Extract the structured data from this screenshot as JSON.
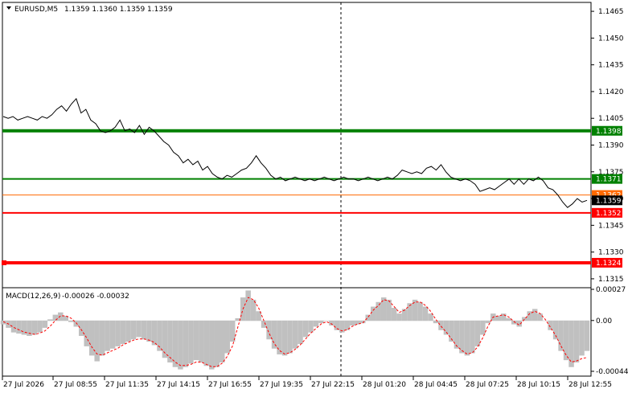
{
  "header": {
    "symbol": "EURUSD,M5",
    "ohlc": "1.1359 1.1360 1.1359 1.1359"
  },
  "macd": {
    "label": "MACD(12,26,9)",
    "values": "-0.00026 -0.00032",
    "y_ticks": [
      "0.00027",
      "0.00",
      "-0.00044"
    ]
  },
  "chart_data": [
    {
      "type": "line",
      "title": "EURUSD,M5",
      "y_ticks": [
        "1.1465",
        "1.1450",
        "1.1435",
        "1.1420",
        "1.1405",
        "1.1390",
        "1.1375",
        "1.1360",
        "1.1345",
        "1.1330",
        "1.1315"
      ],
      "x_ticks": [
        "27 Jul 2026",
        "27 Jul 08:55",
        "27 Jul 11:35",
        "27 Jul 14:15",
        "27 Jul 16:55",
        "27 Jul 19:35",
        "27 Jul 22:15",
        "28 Jul 01:20",
        "28 Jul 04:45",
        "28 Jul 07:25",
        "28 Jul 10:15",
        "28 Jul 12:55"
      ],
      "ylim": [
        1.131,
        1.147
      ],
      "grid": false,
      "series": [
        {
          "values": [
            1.1406,
            1.1405,
            1.1406,
            1.1404,
            1.1405,
            1.1406,
            1.1405,
            1.1404,
            1.1406,
            1.1405,
            1.1407,
            1.141,
            1.1412,
            1.1409,
            1.1413,
            1.1416,
            1.1408,
            1.141,
            1.1404,
            1.1402,
            1.1398,
            1.1397,
            1.1398,
            1.14,
            1.1404,
            1.1398,
            1.1399,
            1.1397,
            1.1401,
            1.1396,
            1.14,
            1.1398,
            1.1395,
            1.1392,
            1.139,
            1.1386,
            1.1384,
            1.138,
            1.1382,
            1.1379,
            1.1381,
            1.1376,
            1.1378,
            1.1374,
            1.1372,
            1.1371,
            1.1373,
            1.1372,
            1.1374,
            1.1376,
            1.1377,
            1.138,
            1.1384,
            1.138,
            1.1377,
            1.1373,
            1.1371,
            1.1372,
            1.137,
            1.1371,
            1.1372,
            1.1371,
            1.137,
            1.1371,
            1.137,
            1.1371,
            1.1372,
            1.1371,
            1.137,
            1.1371,
            1.1372,
            1.1371,
            1.1371,
            1.137,
            1.1371,
            1.1372,
            1.1371,
            1.137,
            1.1371,
            1.1372,
            1.1371,
            1.1373,
            1.1376,
            1.1375,
            1.1374,
            1.1375,
            1.1374,
            1.1377,
            1.1378,
            1.1376,
            1.1379,
            1.1375,
            1.1372,
            1.1371,
            1.137,
            1.1371,
            1.137,
            1.1368,
            1.1364,
            1.1365,
            1.1366,
            1.1365,
            1.1367,
            1.1369,
            1.1371,
            1.1368,
            1.1371,
            1.1368,
            1.1371,
            1.137,
            1.1372,
            1.137,
            1.1366,
            1.1365,
            1.1362,
            1.1358,
            1.1355,
            1.1357,
            1.136,
            1.1358,
            1.1359
          ]
        }
      ],
      "levels": [
        {
          "value": 1.1398,
          "label": "1.1398",
          "color": "#008000"
        },
        {
          "value": 1.1371,
          "label": "1.1371",
          "color": "#008000"
        },
        {
          "value": 1.1362,
          "label": "1.1362",
          "color": "#ff6a00"
        },
        {
          "value": 1.1352,
          "label": "1.1352",
          "color": "#ff0000"
        },
        {
          "value": 1.1324,
          "label": "1.1324",
          "color": "#ff0000"
        }
      ],
      "last_price": {
        "value": 1.1359,
        "label": "1.1359"
      }
    },
    {
      "type": "bar",
      "title": "MACD(12,26,9)",
      "ylim": [
        -0.00044,
        0.00027
      ],
      "histogram": [
        -3e-05,
        -6e-05,
        -0.0001,
        -0.00011,
        -0.00012,
        -0.00013,
        -0.00012,
        -0.0001,
        -6e-05,
        1e-05,
        5e-05,
        7e-05,
        4e-05,
        -1e-05,
        -5e-05,
        -0.00013,
        -0.00022,
        -0.0003,
        -0.00035,
        -0.0003,
        -0.00026,
        -0.00024,
        -0.00022,
        -0.0002,
        -0.00018,
        -0.00016,
        -0.00014,
        -0.00016,
        -0.00018,
        -0.00021,
        -0.00026,
        -0.00032,
        -0.00036,
        -0.0004,
        -0.00042,
        -0.0004,
        -0.00037,
        -0.00034,
        -0.00036,
        -0.00039,
        -0.00042,
        -0.0004,
        -0.00036,
        -0.00028,
        -0.00018,
        2e-05,
        0.0002,
        0.00026,
        0.00018,
        8e-05,
        -6e-05,
        -0.00016,
        -0.00024,
        -0.00029,
        -0.0003,
        -0.00028,
        -0.00024,
        -0.0002,
        -0.00014,
        -0.0001,
        -5e-05,
        -2e-05,
        0.0,
        -4e-05,
        -8e-05,
        -0.0001,
        -8e-05,
        -4e-05,
        -3e-05,
        -2e-05,
        5e-05,
        0.00012,
        0.00016,
        0.0002,
        0.00018,
        0.00011,
        6e-05,
        0.0001,
        0.00015,
        0.00018,
        0.00016,
        0.00012,
        6e-05,
        -2e-05,
        -8e-05,
        -0.00012,
        -0.00018,
        -0.00024,
        -0.00028,
        -0.0003,
        -0.00028,
        -0.00022,
        -0.00012,
        -2e-05,
        6e-05,
        4e-05,
        6e-05,
        2e-05,
        -3e-05,
        -5e-05,
        3e-05,
        8e-05,
        0.0001,
        6e-05,
        0.0,
        -8e-05,
        -0.00016,
        -0.00026,
        -0.00034,
        -0.0004,
        -0.00036,
        -0.0003,
        -0.00026
      ],
      "signal": [
        -1e-05,
        -3e-05,
        -6e-05,
        -8e-05,
        -0.0001,
        -0.00011,
        -0.00012,
        -0.00011,
        -9e-05,
        -5e-05,
        0.0,
        4e-05,
        4e-05,
        2e-05,
        -2e-05,
        -8e-05,
        -0.00015,
        -0.00023,
        -0.00029,
        -0.0003,
        -0.00028,
        -0.00026,
        -0.00024,
        -0.00021,
        -0.00019,
        -0.00017,
        -0.00016,
        -0.00016,
        -0.00017,
        -0.00019,
        -0.00023,
        -0.00028,
        -0.00032,
        -0.00036,
        -0.00039,
        -0.00039,
        -0.00038,
        -0.00036,
        -0.00036,
        -0.00038,
        -0.0004,
        -0.0004,
        -0.00037,
        -0.00031,
        -0.00022,
        -6e-05,
        0.0001,
        0.0002,
        0.00018,
        0.00011,
        0.0,
        -0.00011,
        -0.0002,
        -0.00026,
        -0.00029,
        -0.00028,
        -0.00025,
        -0.00021,
        -0.00016,
        -0.00011,
        -7e-05,
        -3e-05,
        -1e-05,
        -3e-05,
        -7e-05,
        -9e-05,
        -8e-05,
        -5e-05,
        -3e-05,
        -2e-05,
        3e-05,
        9e-05,
        0.00013,
        0.00018,
        0.00017,
        0.00012,
        7e-05,
        9e-05,
        0.00013,
        0.00016,
        0.00016,
        0.00013,
        8e-05,
        1e-05,
        -5e-05,
        -0.0001,
        -0.00016,
        -0.00022,
        -0.00026,
        -0.00029,
        -0.00028,
        -0.00023,
        -0.00015,
        -5e-05,
        3e-05,
        4e-05,
        5e-05,
        3e-05,
        -1e-05,
        -4e-05,
        1e-05,
        6e-05,
        8e-05,
        6e-05,
        1e-05,
        -6e-05,
        -0.00013,
        -0.00022,
        -0.0003,
        -0.00036,
        -0.00035,
        -0.00033,
        -0.00032
      ]
    }
  ],
  "colors": {
    "price_line": "#000000",
    "histogram": "#c0c0c0",
    "signal": "#ff0000",
    "last_price_bg": "#000000",
    "cursor_line": "#000000"
  }
}
